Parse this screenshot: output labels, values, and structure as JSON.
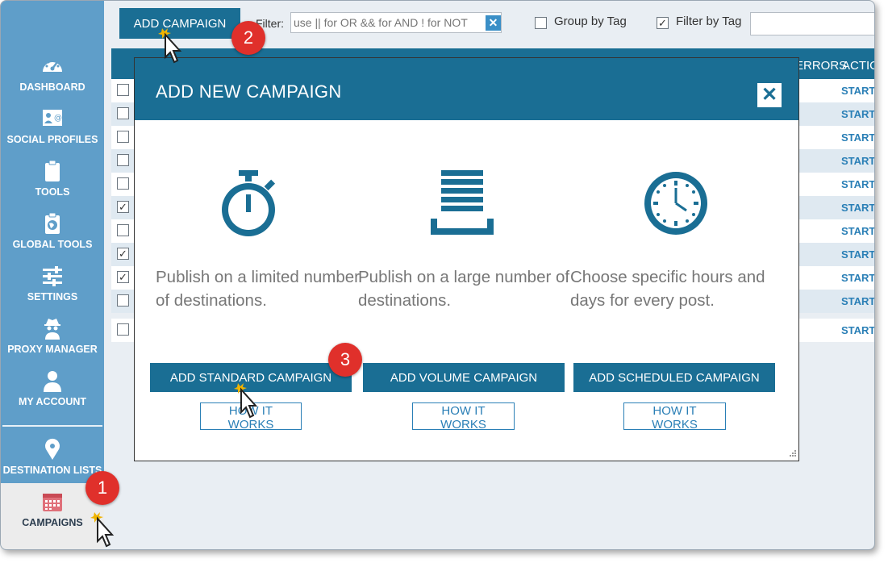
{
  "sidebar": {
    "items": [
      {
        "label": "DASHBOARD",
        "icon": "dashboard-gauge-icon"
      },
      {
        "label": "SOCIAL PROFILES",
        "icon": "social-profiles-icon"
      },
      {
        "label": "TOOLS",
        "icon": "clipboard-icon"
      },
      {
        "label": "GLOBAL TOOLS",
        "icon": "globe-clipboard-icon"
      },
      {
        "label": "SETTINGS",
        "icon": "sliders-icon"
      },
      {
        "label": "PROXY MANAGER",
        "icon": "spy-icon"
      },
      {
        "label": "MY ACCOUNT",
        "icon": "user-icon"
      },
      {
        "label": "DESTINATION LISTS",
        "icon": "map-pin-icon"
      },
      {
        "label": "CAMPAIGNS",
        "icon": "calendar-icon",
        "active": true
      }
    ]
  },
  "toolbar": {
    "add_campaign_label": "ADD CAMPAIGN",
    "filter_label": "Filter:",
    "filter_placeholder": "use || for OR && for AND ! for NOT",
    "filter_clear": "✕",
    "group_by_tag_label": "Group by Tag",
    "group_by_tag_checked": false,
    "filter_by_tag_label": "Filter by Tag",
    "filter_by_tag_checked": true
  },
  "table": {
    "headers": {
      "errors": "ERRORS",
      "actions": "ACTIONS"
    },
    "rows": [
      {
        "checked": false,
        "action": "START"
      },
      {
        "checked": false,
        "action": "START"
      },
      {
        "checked": false,
        "action": "START"
      },
      {
        "checked": false,
        "action": "START"
      },
      {
        "checked": false,
        "action": "START"
      },
      {
        "checked": true,
        "action": "START"
      },
      {
        "checked": false,
        "action": "START"
      },
      {
        "checked": true,
        "action": "START"
      },
      {
        "checked": true,
        "action": "START"
      },
      {
        "checked": false,
        "action": "START"
      },
      {
        "checked": false,
        "action": "START"
      }
    ]
  },
  "modal": {
    "title": "ADD NEW CAMPAIGN",
    "close": "✕",
    "columns": [
      {
        "icon": "stopwatch-icon",
        "description": "Publish on a limited number of destinations.",
        "primary": "ADD STANDARD CAMPAIGN",
        "secondary": "HOW IT WORKS"
      },
      {
        "icon": "stack-icon",
        "description": "Publish on a large number of destinations.",
        "primary": "ADD VOLUME CAMPAIGN",
        "secondary": "HOW IT WORKS"
      },
      {
        "icon": "clock-icon",
        "description": "Choose specific hours and days for every post.",
        "primary": "ADD SCHEDULED CAMPAIGN",
        "secondary": "HOW IT WORKS"
      }
    ]
  },
  "annotations": {
    "step1": "1",
    "step2": "2",
    "step3": "3"
  },
  "colors": {
    "primary": "#1a6e94",
    "sidebar": "#5f9ec9",
    "badge": "#e0302b",
    "link": "#2a7fb6"
  }
}
